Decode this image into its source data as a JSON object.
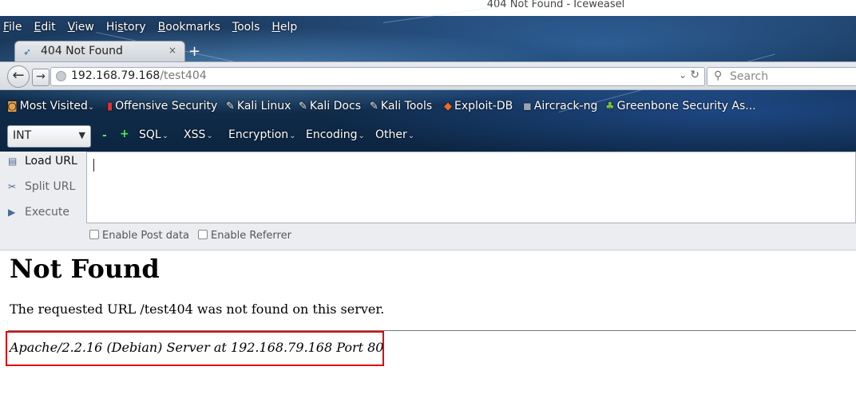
{
  "window": {
    "title": "404 Not Found - Iceweasel"
  },
  "menubar": [
    {
      "first": "F",
      "rest": "ile"
    },
    {
      "first": "E",
      "rest": "dit"
    },
    {
      "first": "V",
      "rest": "iew"
    },
    {
      "first": "",
      "rest": "Hi",
      "u": "s",
      "tail": "tory"
    },
    {
      "first": "B",
      "rest": "ookmarks"
    },
    {
      "first": "T",
      "rest": "ools"
    },
    {
      "first": "H",
      "rest": "elp"
    }
  ],
  "tab": {
    "title": "404 Not Found",
    "close": "×",
    "new": "+"
  },
  "nav": {
    "back": "←",
    "forward": "→",
    "url_host": "192.168.79.168",
    "url_path": "/test404",
    "dropdown": "⌄",
    "reload": "↻",
    "search_placeholder": "Search"
  },
  "bookmarks": [
    {
      "label": "Most Visited",
      "icon": "◙",
      "icon_name": "most-visited-icon",
      "dropdown": "⌄"
    },
    {
      "label": "Offensive Security",
      "icon": "▮",
      "icon_name": "offensive-security-icon"
    },
    {
      "label": "Kali Linux",
      "icon": "✎",
      "icon_name": "kali-dragon-icon"
    },
    {
      "label": "Kali Docs",
      "icon": "✎",
      "icon_name": "kali-dragon-icon"
    },
    {
      "label": "Kali Tools",
      "icon": "✎",
      "icon_name": "kali-dragon-icon"
    },
    {
      "label": "Exploit-DB",
      "icon": "◆",
      "icon_name": "exploit-db-icon"
    },
    {
      "label": "Aircrack-ng",
      "icon": "◼",
      "icon_name": "aircrack-icon"
    },
    {
      "label": "Greenbone Security As...",
      "icon": "♣",
      "icon_name": "greenbone-icon"
    }
  ],
  "hackbar": {
    "select_value": "INT",
    "minus": "-",
    "plus": "+",
    "menus": [
      "SQL",
      "XSS",
      "Encryption",
      "Encoding",
      "Other"
    ],
    "side_buttons": [
      "Load URL",
      "Split URL",
      "Execute"
    ],
    "checkboxes": [
      "Enable Post data",
      "Enable Referrer"
    ]
  },
  "page": {
    "heading": "Not Found",
    "message": "The requested URL /test404 was not found on this server.",
    "address": "Apache/2.2.16 (Debian) Server at 192.168.79.168 Port 80"
  },
  "colors": {
    "highlight": "#e00000",
    "hackbar_green": "#5be35b"
  }
}
